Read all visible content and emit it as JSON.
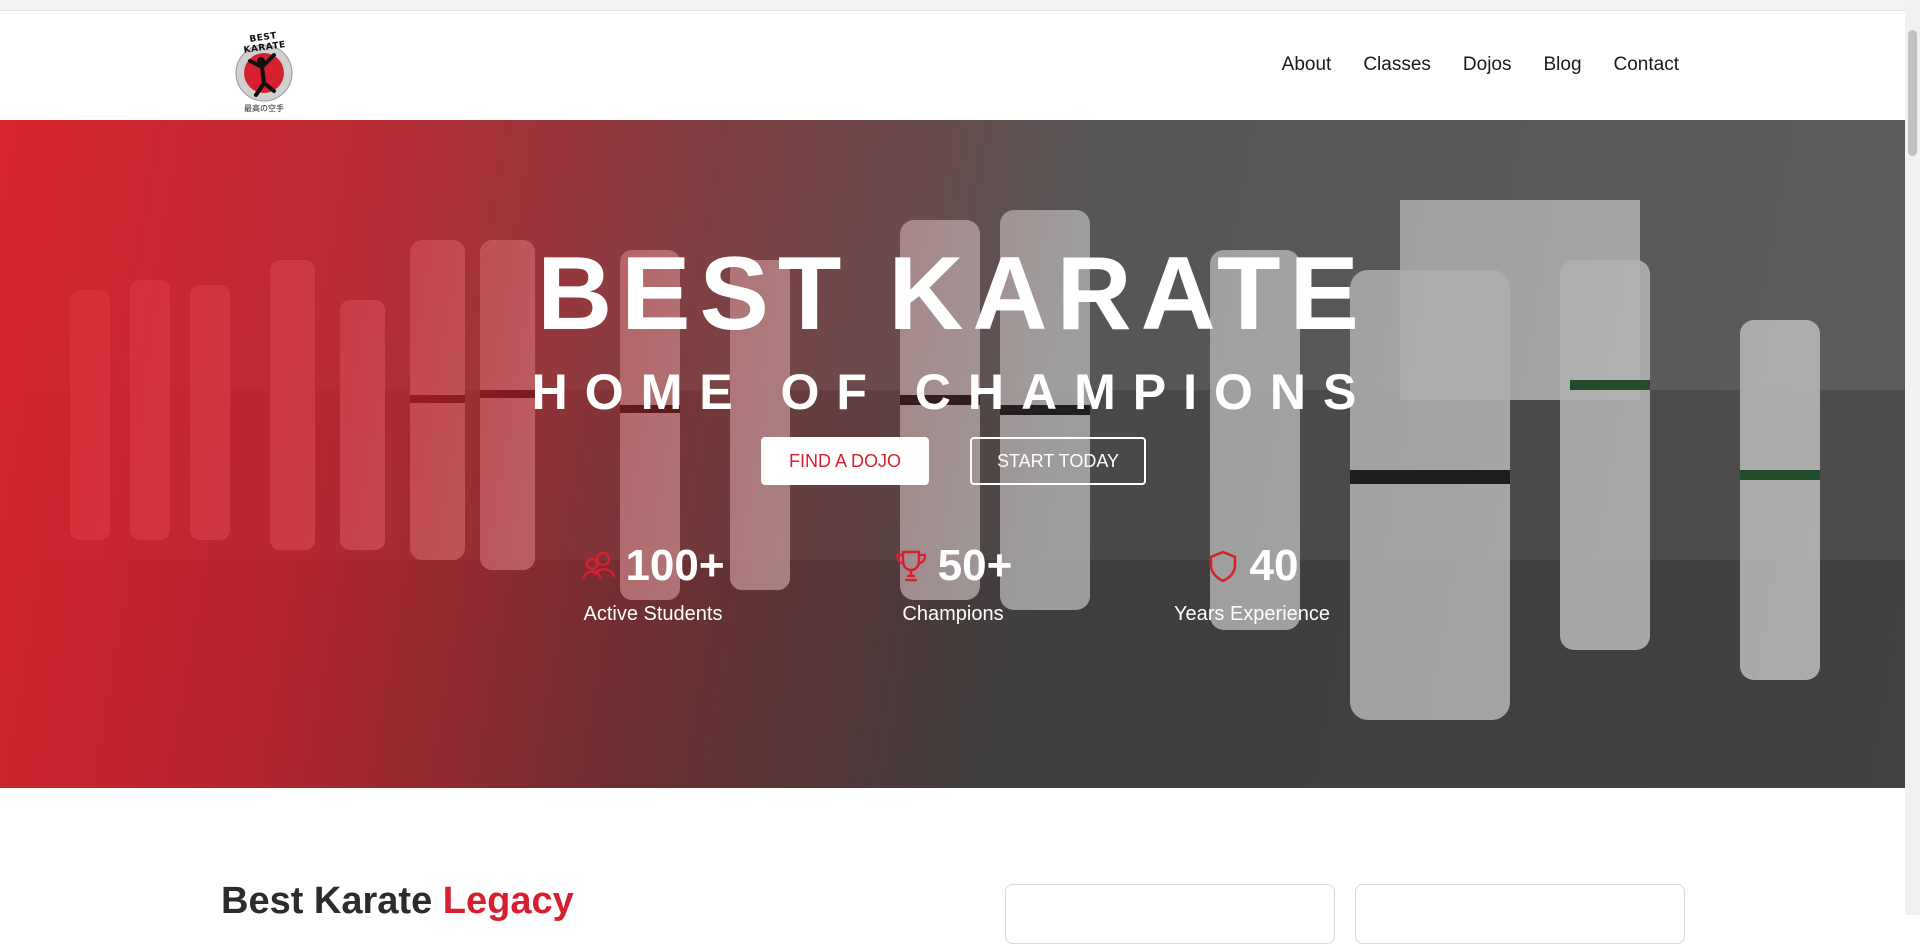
{
  "header": {
    "logo_top": "BEST KARATE",
    "logo_bottom": "最高の空手",
    "nav": [
      "About",
      "Classes",
      "Dojos",
      "Blog",
      "Contact"
    ]
  },
  "hero": {
    "title": "BEST KARATE",
    "subtitle": "HOME OF CHAMPIONS",
    "buttons": {
      "find": "FIND A DOJO",
      "start": "START TODAY"
    },
    "stats": [
      {
        "icon": "users-icon",
        "value": "100+",
        "label": "Active Students"
      },
      {
        "icon": "trophy-icon",
        "value": "50+",
        "label": "Champions"
      },
      {
        "icon": "shield-icon",
        "value": "40",
        "label": "Years Experience"
      }
    ]
  },
  "legacy": {
    "title_main": "Best Karate ",
    "title_accent": "Legacy"
  },
  "colors": {
    "accent": "#d62030",
    "text": "#1a1a1a"
  }
}
